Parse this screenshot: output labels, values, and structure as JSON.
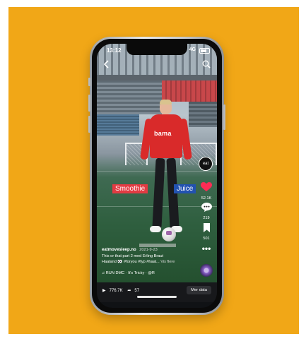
{
  "status_bar": {
    "time": "13:12",
    "carrier": "4G"
  },
  "overlay": {
    "left_label": "Smoothie",
    "right_label": "Juice"
  },
  "jersey": {
    "sponsor": "bama"
  },
  "side_actions": {
    "avatar_text": "eat",
    "likes": "52.1K",
    "comments": "219",
    "saves": "501",
    "more": "•••"
  },
  "caption": {
    "username": "eatmovesleep.no",
    "date": "2021-9-23",
    "line1": "This or that part 2 med Erling Braut",
    "line2": "Haaland",
    "hashtags": "#foryou #fyp #haal...",
    "see_more": "Vis flere"
  },
  "music": {
    "text": "RUN DMC · It's Tricky · @R"
  },
  "bottom_bar": {
    "views": "776.7K",
    "shares": "57",
    "more_data_button": "Mer data"
  },
  "icons": [
    "back-icon",
    "search-icon",
    "heart-icon",
    "comment-icon",
    "bookmark-icon",
    "more-icon",
    "music-note-icon",
    "play-icon",
    "share-icon"
  ],
  "colors": {
    "background": "#f1a717",
    "smoothie": "#e23b43",
    "juice": "#2252b0",
    "heart": "#fe2c55"
  }
}
